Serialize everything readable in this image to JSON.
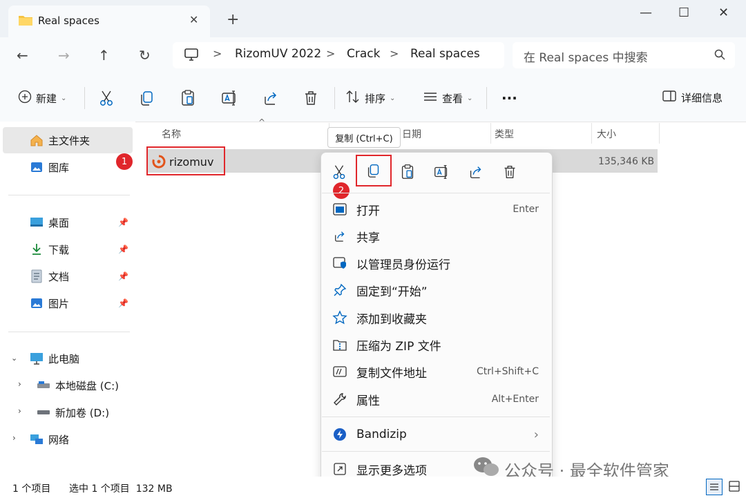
{
  "tab": {
    "title": "Real spaces",
    "close": "✕"
  },
  "newtab": "+",
  "window": {
    "minimize": "—",
    "maximize": "☐",
    "close": "✕"
  },
  "nav": {
    "back": "←",
    "forward": "→",
    "up": "↑",
    "refresh": "↻"
  },
  "breadcrumb": {
    "sep": ">",
    "items": [
      "RizomUV 2022",
      "Crack",
      "Real spaces"
    ]
  },
  "search": {
    "placeholder": "在 Real spaces 中搜索"
  },
  "commands": {
    "new": "新建",
    "sort": "排序",
    "view": "查看",
    "more": "···",
    "details": "详细信息"
  },
  "sidebar": {
    "home": "主文件夹",
    "gallery": "图库",
    "desktop": "桌面",
    "downloads": "下载",
    "documents": "文档",
    "pictures": "图片",
    "thispc": "此电脑",
    "drive_c": "本地磁盘 (C:)",
    "drive_d": "新加卷 (D:)",
    "network": "网络"
  },
  "columns": {
    "name": "名称",
    "date": "日期",
    "type": "类型",
    "size": "大小"
  },
  "file": {
    "name": "rizomuv",
    "size": "135,346 KB"
  },
  "tooltip": "复制 (Ctrl+C)",
  "badges": {
    "one": "1",
    "two": "2"
  },
  "menu": {
    "open": {
      "label": "打开",
      "shortcut": "Enter"
    },
    "share": {
      "label": "共享"
    },
    "runadmin": {
      "label": "以管理员身份运行"
    },
    "pinstart": {
      "label": "固定到“开始”"
    },
    "favorite": {
      "label": "添加到收藏夹"
    },
    "zip": {
      "label": "压缩为 ZIP 文件"
    },
    "copypath": {
      "label": "复制文件地址",
      "shortcut": "Ctrl+Shift+C"
    },
    "properties": {
      "label": "属性",
      "shortcut": "Alt+Enter"
    },
    "bandizip": {
      "label": "Bandizip"
    },
    "more": {
      "label": "显示更多选项"
    }
  },
  "status": {
    "count": "1 个项目",
    "selected": "选中 1 个项目  132 MB"
  },
  "watermark": "公众号 · 最全软件管家",
  "colors": {
    "accent": "#0067c0",
    "red": "#e0262b",
    "selected_row": "#d9d9d9"
  }
}
